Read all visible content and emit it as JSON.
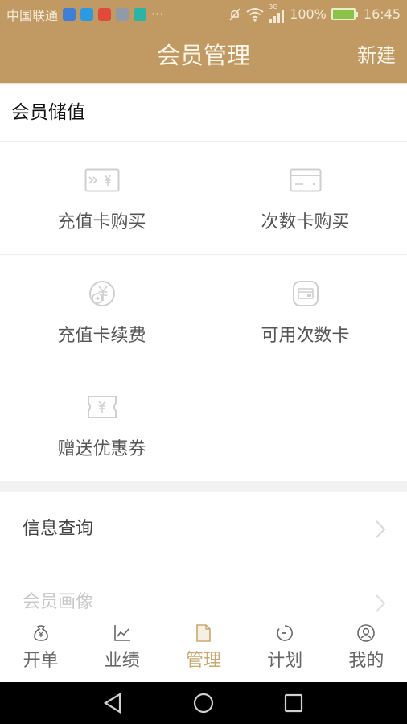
{
  "status_bar": {
    "carrier": "中国联通",
    "overflow": "···",
    "network": "3G",
    "battery": "100%",
    "time": "16:45",
    "notification_colors": [
      "#3f7fd6",
      "#2a9be0",
      "#e04a3a",
      "#8f9aa6",
      "#2bb3a4"
    ]
  },
  "header": {
    "title": "会员管理",
    "action_label": "新建"
  },
  "section": {
    "title": "会员储值"
  },
  "grid": [
    {
      "label": "充值卡购买",
      "icon": "card-transfer-yuan-icon"
    },
    {
      "label": "次数卡购买",
      "icon": "credit-card-icon"
    },
    {
      "label": "充值卡续费",
      "icon": "yuan-renew-icon"
    },
    {
      "label": "可用次数卡",
      "icon": "card-wallet-icon"
    },
    {
      "label": "赠送优惠券",
      "icon": "coupon-icon"
    }
  ],
  "list": [
    {
      "label": "信息查询"
    },
    {
      "label": "会员画像"
    }
  ],
  "tabs": [
    {
      "label": "开单",
      "icon": "money-bag-icon",
      "active": false
    },
    {
      "label": "业绩",
      "icon": "line-chart-icon",
      "active": false
    },
    {
      "label": "管理",
      "icon": "document-icon",
      "active": true
    },
    {
      "label": "计划",
      "icon": "timer-icon",
      "active": false
    },
    {
      "label": "我的",
      "icon": "user-circle-icon",
      "active": false
    }
  ],
  "colors": {
    "brand": "#c19a63",
    "active_tab": "#c9a86e"
  }
}
